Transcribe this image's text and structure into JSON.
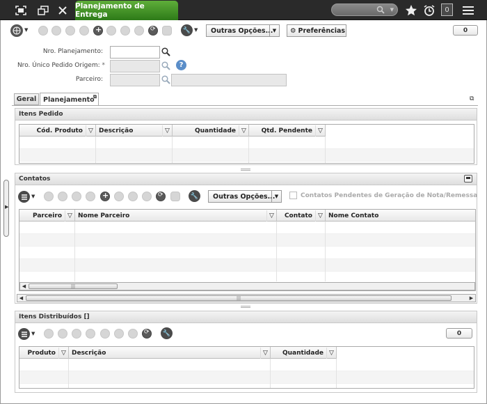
{
  "app": {
    "tab_title": "Planejamento de Entrega",
    "notification_count": "0"
  },
  "toolbar": {
    "more_options": "Outras Opções...",
    "preferences": "Preferências",
    "record_count": "0"
  },
  "form": {
    "nro_planejamento": "Nro. Planejamento:",
    "nro_unico_pedido": "Nro. Único Pedido Origem: ",
    "parceiro": "Parceiro:"
  },
  "tabs": {
    "geral": "Geral",
    "planejamento": "Planejamento"
  },
  "itens_pedido": {
    "title": "Itens Pedido",
    "columns": [
      "Cód. Produto",
      "Descrição",
      "Quantidade",
      "Qtd. Pendente"
    ]
  },
  "contatos": {
    "title": "Contatos",
    "more_options": "Outras Opções...",
    "pending_label": "Contatos Pendentes de Geração de Nota/Remessa",
    "columns": [
      "Parceiro",
      "Nome Parceiro",
      "Contato",
      "Nome Contato"
    ]
  },
  "itens_distribuidos": {
    "title": "Itens Distribuídos []",
    "record_count": "0",
    "columns": [
      "Produto",
      "Descrição",
      "Quantidade"
    ]
  },
  "colors": {
    "active_tab": "#3f9426",
    "topbar": "#2a2a2a"
  }
}
